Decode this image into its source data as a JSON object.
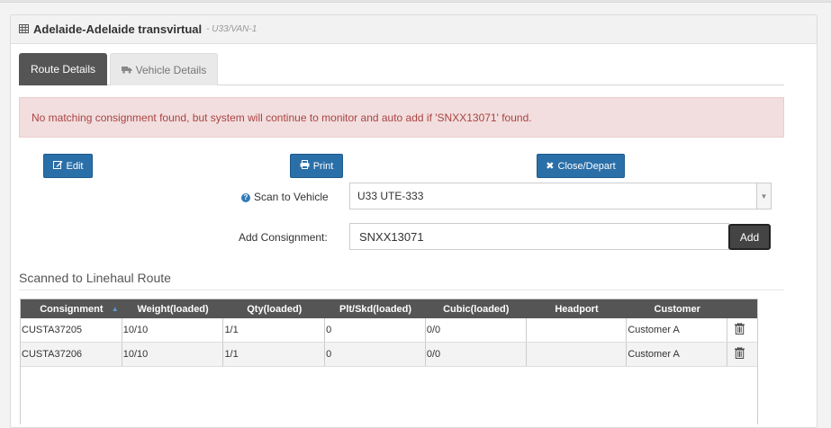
{
  "header": {
    "icon": "table-grid-icon",
    "title": "Adelaide-Adelaide transvirtual",
    "subtitle": "- U33/VAN-1"
  },
  "tabs": [
    {
      "label": "Route Details",
      "active": true
    },
    {
      "label": "Vehicle Details",
      "active": false,
      "icon": "truck-icon"
    }
  ],
  "alert": {
    "message": "No matching consignment found, but system will continue to monitor and auto add if 'SNXX13071' found."
  },
  "buttons": {
    "edit": "Edit",
    "print": "Print",
    "close_depart": "Close/Depart",
    "add": "Add"
  },
  "form": {
    "scan_label": "Scan to Vehicle",
    "scan_value": "U33 UTE-333",
    "consignment_label": "Add Consignment:",
    "consignment_value": "SNXX13071"
  },
  "section_title": "Scanned to Linehaul Route",
  "table": {
    "columns": [
      "Consignment",
      "Weight(loaded)",
      "Qty(loaded)",
      "Plt/Skd(loaded)",
      "Cubic(loaded)",
      "Headport",
      "Customer",
      ""
    ],
    "rows": [
      [
        "CUSTA37205",
        "10/10",
        "1/1",
        "0",
        "0/0",
        "",
        "Customer A"
      ],
      [
        "CUSTA37206",
        "10/10",
        "1/1",
        "0",
        "0/0",
        "",
        "Customer A"
      ]
    ]
  },
  "colors": {
    "primary_button": "#2b6fa8",
    "alert_bg": "#f2dede",
    "alert_text": "#a94442",
    "table_header": "#555555"
  }
}
